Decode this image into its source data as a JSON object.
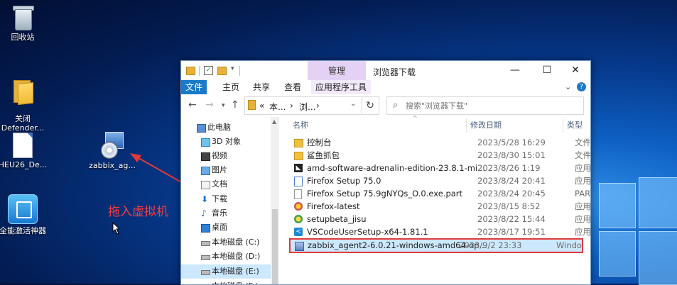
{
  "desktop": {
    "icons": [
      {
        "label": "回收站"
      },
      {
        "label": "关闭\nDefender..."
      },
      {
        "label": "HEU26_De..."
      },
      {
        "label": "全能激活神器"
      },
      {
        "label": "zabbix_ag..."
      }
    ],
    "annotation": "拖入虚拟机"
  },
  "explorer": {
    "title": "浏览器下载",
    "manage_tab": "管理",
    "ribbon_tabs": [
      "文件",
      "主页",
      "共享",
      "查看",
      "应用程序工具"
    ],
    "address": {
      "seg1": "«",
      "seg2": "本...",
      "seg3": "›",
      "seg4": "浏...",
      "seg5": "›"
    },
    "search_placeholder": "搜索\"浏览器下载\"",
    "nav_items": [
      {
        "label": "此电脑",
        "icon": "computer-icon"
      },
      {
        "label": "3D 对象",
        "icon": "3d-objects-icon"
      },
      {
        "label": "视频",
        "icon": "video-icon"
      },
      {
        "label": "图片",
        "icon": "pictures-icon"
      },
      {
        "label": "文档",
        "icon": "documents-icon"
      },
      {
        "label": "下载",
        "icon": "downloads-icon"
      },
      {
        "label": "音乐",
        "icon": "music-icon"
      },
      {
        "label": "桌面",
        "icon": "desktop-icon"
      },
      {
        "label": "本地磁盘 (C:)",
        "icon": "drive-icon"
      },
      {
        "label": "本地磁盘 (D:)",
        "icon": "drive-icon"
      },
      {
        "label": "本地磁盘 (E:)",
        "icon": "drive-icon"
      },
      {
        "label": "本地磁盘 (F:)",
        "icon": "drive-icon"
      }
    ],
    "columns": {
      "name": "名称",
      "date": "修改日期",
      "type": "类型"
    },
    "files": [
      {
        "name": "控制台",
        "date": "2023/5/28 16:29",
        "type": "文件夹",
        "icon": "folder-icon",
        "color": "#f0c03f"
      },
      {
        "name": "鲨鱼抓包",
        "date": "2023/8/30 15:01",
        "type": "文件夹",
        "icon": "folder-icon",
        "color": "#f0c03f"
      },
      {
        "name": "amd-software-adrenalin-edition-23.8.1-mi...",
        "date": "2023/8/26 1:19",
        "type": "应用程",
        "icon": "amd-icon",
        "color": "#222222"
      },
      {
        "name": "Firefox Setup 75.0",
        "date": "2023/8/24 20:41",
        "type": "应用程",
        "icon": "installer-icon",
        "color": "#4a7fd4"
      },
      {
        "name": "Firefox Setup 75.9gNYQs_O.0.exe.part",
        "date": "2023/8/24 20:45",
        "type": "PART 文",
        "icon": "document-icon",
        "color": "#ffffff"
      },
      {
        "name": "Firefox-latest",
        "date": "2023/8/15 8:52",
        "type": "应用程",
        "icon": "firefox-icon",
        "color": "#e8622a"
      },
      {
        "name": "setupbeta_jisu",
        "date": "2023/8/22 15:44",
        "type": "应用程",
        "icon": "jisu-icon",
        "color": "#3aa34b"
      },
      {
        "name": "VSCodeUserSetup-x64-1.81.1",
        "date": "2023/8/17 19:51",
        "type": "应用程",
        "icon": "vscode-icon",
        "color": "#1e8ad6"
      },
      {
        "name": "zabbix_agent2-6.0.21-windows-amd64-op...",
        "date": "2023/9/2 23:33",
        "type": "Windo",
        "icon": "msi-icon",
        "color": "#5d86c4"
      }
    ]
  },
  "colors": {
    "accent": "#1979ca",
    "highlight": "#cce8ff",
    "annotation": "#ff3b3b",
    "manage_tab": "#e3d2f3"
  }
}
